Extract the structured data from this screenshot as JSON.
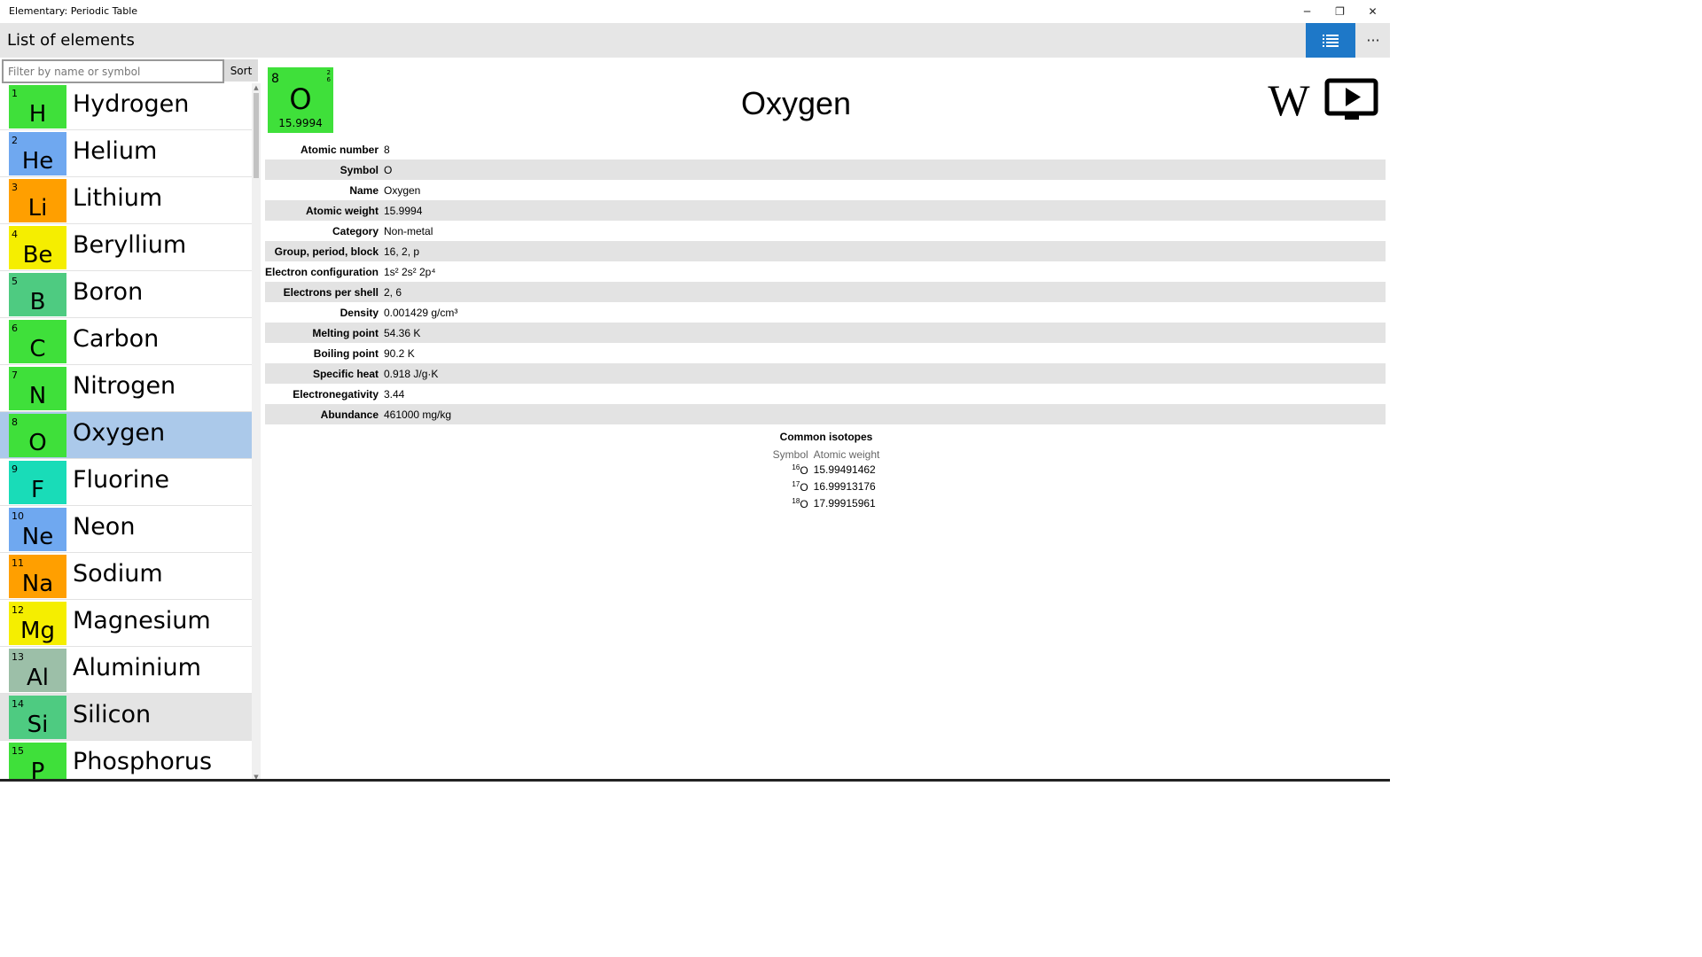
{
  "window": {
    "title": "Elementary: Periodic Table",
    "minimize": "─",
    "maximize": "❐",
    "close": "✕"
  },
  "header": {
    "title": "List of elements",
    "more": "···"
  },
  "filter": {
    "placeholder": "Filter by name or symbol",
    "value": "",
    "sort_label": "Sort"
  },
  "elements": [
    {
      "number": "1",
      "symbol": "H",
      "name": "Hydrogen",
      "color": "#3fe03a"
    },
    {
      "number": "2",
      "symbol": "He",
      "name": "Helium",
      "color": "#6fa8f0"
    },
    {
      "number": "3",
      "symbol": "Li",
      "name": "Lithium",
      "color": "#ff9f00"
    },
    {
      "number": "4",
      "symbol": "Be",
      "name": "Beryllium",
      "color": "#f5ee00"
    },
    {
      "number": "5",
      "symbol": "B",
      "name": "Boron",
      "color": "#4ecb81"
    },
    {
      "number": "6",
      "symbol": "C",
      "name": "Carbon",
      "color": "#3fe03a"
    },
    {
      "number": "7",
      "symbol": "N",
      "name": "Nitrogen",
      "color": "#3fe03a"
    },
    {
      "number": "8",
      "symbol": "O",
      "name": "Oxygen",
      "color": "#3fe03a",
      "selected": true
    },
    {
      "number": "9",
      "symbol": "F",
      "name": "Fluorine",
      "color": "#19dcb8"
    },
    {
      "number": "10",
      "symbol": "Ne",
      "name": "Neon",
      "color": "#6fa8f0"
    },
    {
      "number": "11",
      "symbol": "Na",
      "name": "Sodium",
      "color": "#ff9f00"
    },
    {
      "number": "12",
      "symbol": "Mg",
      "name": "Magnesium",
      "color": "#f5ee00"
    },
    {
      "number": "13",
      "symbol": "Al",
      "name": "Aluminium",
      "color": "#9cbfa8"
    },
    {
      "number": "14",
      "symbol": "Si",
      "name": "Silicon",
      "color": "#4ecb81",
      "hover": true
    },
    {
      "number": "15",
      "symbol": "P",
      "name": "Phosphorus",
      "color": "#3fe03a"
    }
  ],
  "detail": {
    "number": "8",
    "symbol": "O",
    "name": "Oxygen",
    "weight": "15.9994",
    "shells": [
      "2",
      "6"
    ],
    "tile_color": "#3fe03a",
    "wiki_icon_glyph": "W",
    "properties": [
      {
        "label": "Atomic number",
        "value": "8"
      },
      {
        "label": "Symbol",
        "value": "O"
      },
      {
        "label": "Name",
        "value": "Oxygen"
      },
      {
        "label": "Atomic weight",
        "value": "15.9994"
      },
      {
        "label": "Category",
        "value": "Non-metal"
      },
      {
        "label": "Group, period, block",
        "value": "16, 2, p"
      },
      {
        "label": "Electron configuration",
        "value": "1s² 2s² 2p⁴"
      },
      {
        "label": "Electrons per shell",
        "value": "2, 6"
      },
      {
        "label": "Density",
        "value": "0.001429 g/cm³"
      },
      {
        "label": "Melting point",
        "value": "54.36 K"
      },
      {
        "label": "Boiling point",
        "value": "90.2 K"
      },
      {
        "label": "Specific heat",
        "value": "0.918 J/g·K"
      },
      {
        "label": "Electronegativity",
        "value": "3.44"
      },
      {
        "label": "Abundance",
        "value": "461000 mg/kg"
      }
    ],
    "isotopes": {
      "title": "Common isotopes",
      "headers": [
        "Symbol",
        "Atomic weight"
      ],
      "rows": [
        {
          "mass": "16",
          "symbol": "O",
          "weight": "15.99491462"
        },
        {
          "mass": "17",
          "symbol": "O",
          "weight": "16.99913176"
        },
        {
          "mass": "18",
          "symbol": "O",
          "weight": "17.99915961"
        }
      ]
    }
  }
}
